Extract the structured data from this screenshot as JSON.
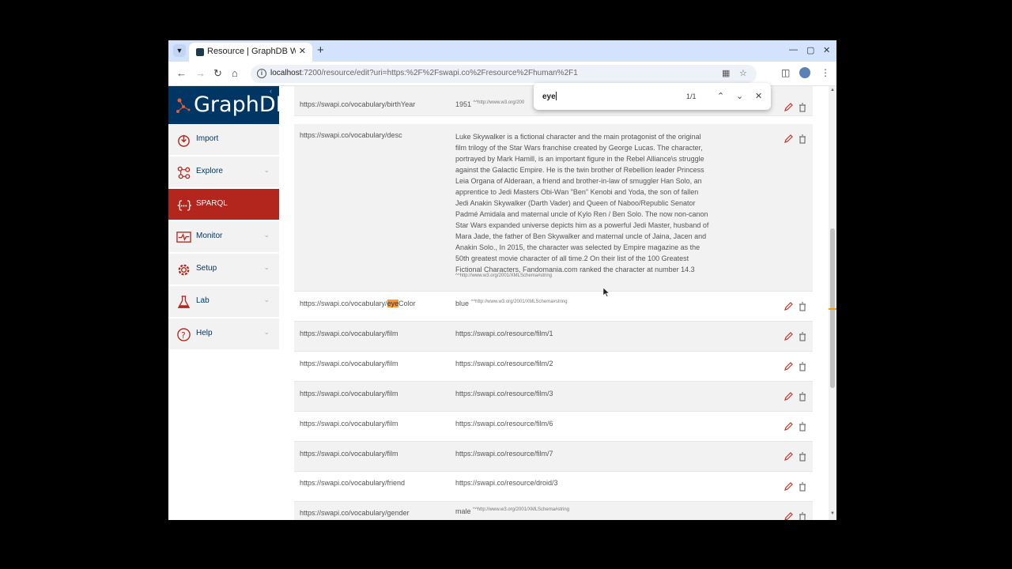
{
  "browser": {
    "tab_title": "Resource | GraphDB Wo",
    "tab_list_icon": "chevron-down-icon",
    "url_host": "localhost",
    "url_rest": ":7200/resource/edit?uri=https:%2F%2Fswapi.co%2Fresource%2Fhuman%2F1"
  },
  "find": {
    "query": "eye",
    "count": "1/1"
  },
  "logo": {
    "text": "GraphDB"
  },
  "lang": {
    "label": "en"
  },
  "menu": [
    {
      "label": "Import",
      "icon": "import-icon"
    },
    {
      "label": "Explore",
      "icon": "explore-icon"
    },
    {
      "label": "SPARQL",
      "icon": "sparql-icon",
      "active": true
    },
    {
      "label": "Monitor",
      "icon": "monitor-icon"
    },
    {
      "label": "Setup",
      "icon": "gear-icon"
    },
    {
      "label": "Lab",
      "icon": "flask-icon"
    },
    {
      "label": "Help",
      "icon": "help-icon"
    }
  ],
  "rows": [
    {
      "predicate": "https://swapi.co/vocabulary/birthYear",
      "object": "1951",
      "datatype": "^^http://www.w3.org/200"
    },
    {
      "predicate": "https://swapi.co/vocabulary/desc",
      "object": "Luke Skywalker is a fictional character and the main protagonist of the original film trilogy of the Star Wars franchise created by George Lucas. The character, portrayed by Mark Hamill, is an important figure in the Rebel Alliance\\s struggle against the Galactic Empire. He is the twin brother of Rebellion leader Princess Leia Organa of Alderaan, a friend and brother-in-law of smuggler Han Solo, an apprentice to Jedi Masters Obi-Wan \"Ben\" Kenobi and Yoda, the son of fallen Jedi Anakin Skywalker (Darth Vader) and Queen of Naboo/Republic Senator Padmé Amidala and maternal uncle of Kylo Ren / Ben Solo. The now non-canon Star Wars expanded universe depicts him as a powerful Jedi Master, husband of Mara Jade, the father of Ben Skywalker and maternal uncle of Jaina, Jacen and Anakin Solo., In 2015, the character was selected by Empire magazine as the 50th greatest movie character of all time.2 On their list of the 100 Greatest Fictional Characters, Fandomania.com ranked the character at number 14.3",
      "datatype": "^^http://www.w3.org/2001/XMLSchema#string"
    },
    {
      "predicate_pre": "https://swapi.co/vocabulary/",
      "predicate_hl": "eye",
      "predicate_post": "Color",
      "object": "blue",
      "datatype": "^^http://www.w3.org/2001/XMLSchema#string"
    },
    {
      "predicate": "https://swapi.co/vocabulary/film",
      "object": "https://swapi.co/resource/film/1"
    },
    {
      "predicate": "https://swapi.co/vocabulary/film",
      "object": "https://swapi.co/resource/film/2"
    },
    {
      "predicate": "https://swapi.co/vocabulary/film",
      "object": "https://swapi.co/resource/film/3"
    },
    {
      "predicate": "https://swapi.co/vocabulary/film",
      "object": "https://swapi.co/resource/film/6"
    },
    {
      "predicate": "https://swapi.co/vocabulary/film",
      "object": "https://swapi.co/resource/film/7"
    },
    {
      "predicate": "https://swapi.co/vocabulary/friend",
      "object": "https://swapi.co/resource/droid/3"
    },
    {
      "predicate": "https://swapi.co/vocabulary/gender",
      "object": "male",
      "datatype": "^^http://www.w3.org/2001/XMLSchema#string"
    }
  ],
  "colors": {
    "brand": "#003663",
    "active": "#b3261e",
    "highlight": "#ff9632",
    "edit_icon": "#c0392b"
  }
}
